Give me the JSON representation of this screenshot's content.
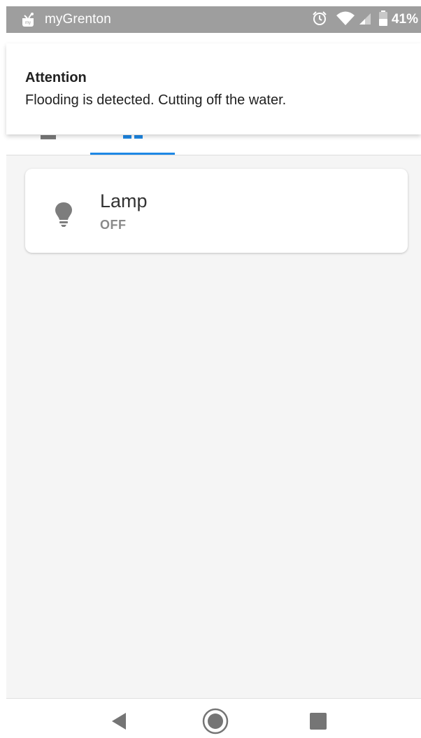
{
  "status_bar": {
    "app_name": "myGrenton",
    "app_icon": "mygrenton-app-icon",
    "battery_percent": "41%",
    "icons": [
      "alarm-clock-icon",
      "wifi-icon",
      "cell-signal-icon",
      "battery-icon"
    ],
    "background_color": "#9e9e9e"
  },
  "notification": {
    "title": "Attention",
    "message": "Flooding is detected. Cutting off the water."
  },
  "tabs": {
    "items": [
      {
        "icon": "tab-icon-left",
        "active": false
      },
      {
        "icon": "tab-icon-grid",
        "active": true
      }
    ],
    "accent_color": "#1e88e5"
  },
  "devices": [
    {
      "name": "Lamp",
      "state": "OFF",
      "icon": "light-bulb-icon"
    }
  ],
  "nav_bar": {
    "buttons": [
      "back-icon",
      "home-icon",
      "recents-icon"
    ]
  }
}
